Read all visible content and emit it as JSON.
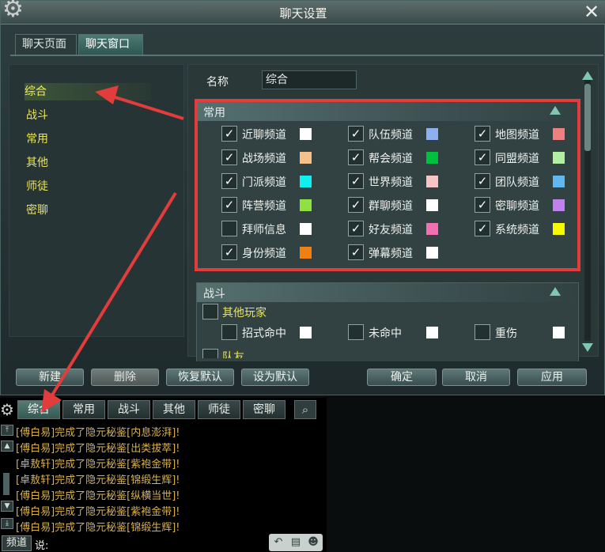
{
  "window": {
    "title": "聊天设置"
  },
  "tabs": [
    "聊天页面",
    "聊天窗口"
  ],
  "categories": [
    "综合",
    "战斗",
    "常用",
    "其他",
    "师徒",
    "密聊"
  ],
  "name_field": {
    "label": "名称",
    "value": "综合"
  },
  "group_common": {
    "title": "常用",
    "channels": [
      {
        "label": "近聊频道",
        "checked": true,
        "color": "#ffffff"
      },
      {
        "label": "队伍频道",
        "checked": true,
        "color": "#8fb0f0"
      },
      {
        "label": "地图频道",
        "checked": true,
        "color": "#f08080"
      },
      {
        "label": "战场频道",
        "checked": true,
        "color": "#f6c08a"
      },
      {
        "label": "帮会频道",
        "checked": true,
        "color": "#00c040"
      },
      {
        "label": "同盟频道",
        "checked": true,
        "color": "#b0f0a0"
      },
      {
        "label": "门派频道",
        "checked": true,
        "color": "#10f0f0"
      },
      {
        "label": "世界频道",
        "checked": true,
        "color": "#f8c4c4"
      },
      {
        "label": "团队频道",
        "checked": true,
        "color": "#60b8f0"
      },
      {
        "label": "阵营频道",
        "checked": true,
        "color": "#90e040"
      },
      {
        "label": "群聊频道",
        "checked": true,
        "color": "#ffffff"
      },
      {
        "label": "密聊频道",
        "checked": true,
        "color": "#c080f0"
      },
      {
        "label": "拜师信息",
        "checked": false,
        "color": "#ffffff"
      },
      {
        "label": "好友频道",
        "checked": true,
        "color": "#f070b0"
      },
      {
        "label": "系统频道",
        "checked": true,
        "color": "#f8f800"
      },
      {
        "label": "身份频道",
        "checked": true,
        "color": "#f08010"
      },
      {
        "label": "弹幕频道",
        "checked": true,
        "color": "#ffffff"
      }
    ]
  },
  "group_battle": {
    "title": "战斗",
    "subgroup": "其他玩家",
    "items": [
      {
        "label": "招式命中",
        "checked": false,
        "color": "#ffffff"
      },
      {
        "label": "未命中",
        "checked": false,
        "color": "#ffffff"
      },
      {
        "label": "重伤",
        "checked": false,
        "color": "#ffffff"
      }
    ],
    "next_subgroup": "队友"
  },
  "buttons": {
    "new": "新建",
    "delete": "删除",
    "restore": "恢复默认",
    "set_default": "设为默认",
    "ok": "确定",
    "cancel": "取消",
    "apply": "应用"
  },
  "chat": {
    "tabs": [
      "综合",
      "常用",
      "战斗",
      "其他",
      "师徒",
      "密聊"
    ],
    "lines": [
      "[傅白易]完成了隐元秘鉴[内息澎湃]!",
      "[傅白易]完成了隐元秘鉴[出类拔萃]!",
      "[卓敖轩]完成了隐元秘鉴[紫袍金带]!",
      "[卓敖轩]完成了隐元秘鉴[锦缎生辉]!",
      "[傅白易]完成了隐元秘鉴[纵横当世]!",
      "[傅白易]完成了隐元秘鉴[紫袍金带]!",
      "[傅白易]完成了隐元秘鉴[锦缎生辉]!"
    ],
    "channel_button": "频道",
    "say_label": "说:"
  },
  "colors": {
    "highlight_box": "#e23c3c",
    "category_text": "#e9e45a",
    "chat_text": "#d9b04a",
    "arrow": "#e23c3c"
  },
  "icons": [
    "gear-icon",
    "close-icon",
    "search-icon",
    "scroll-up-icon",
    "scroll-down-icon",
    "collapse-icon"
  ]
}
